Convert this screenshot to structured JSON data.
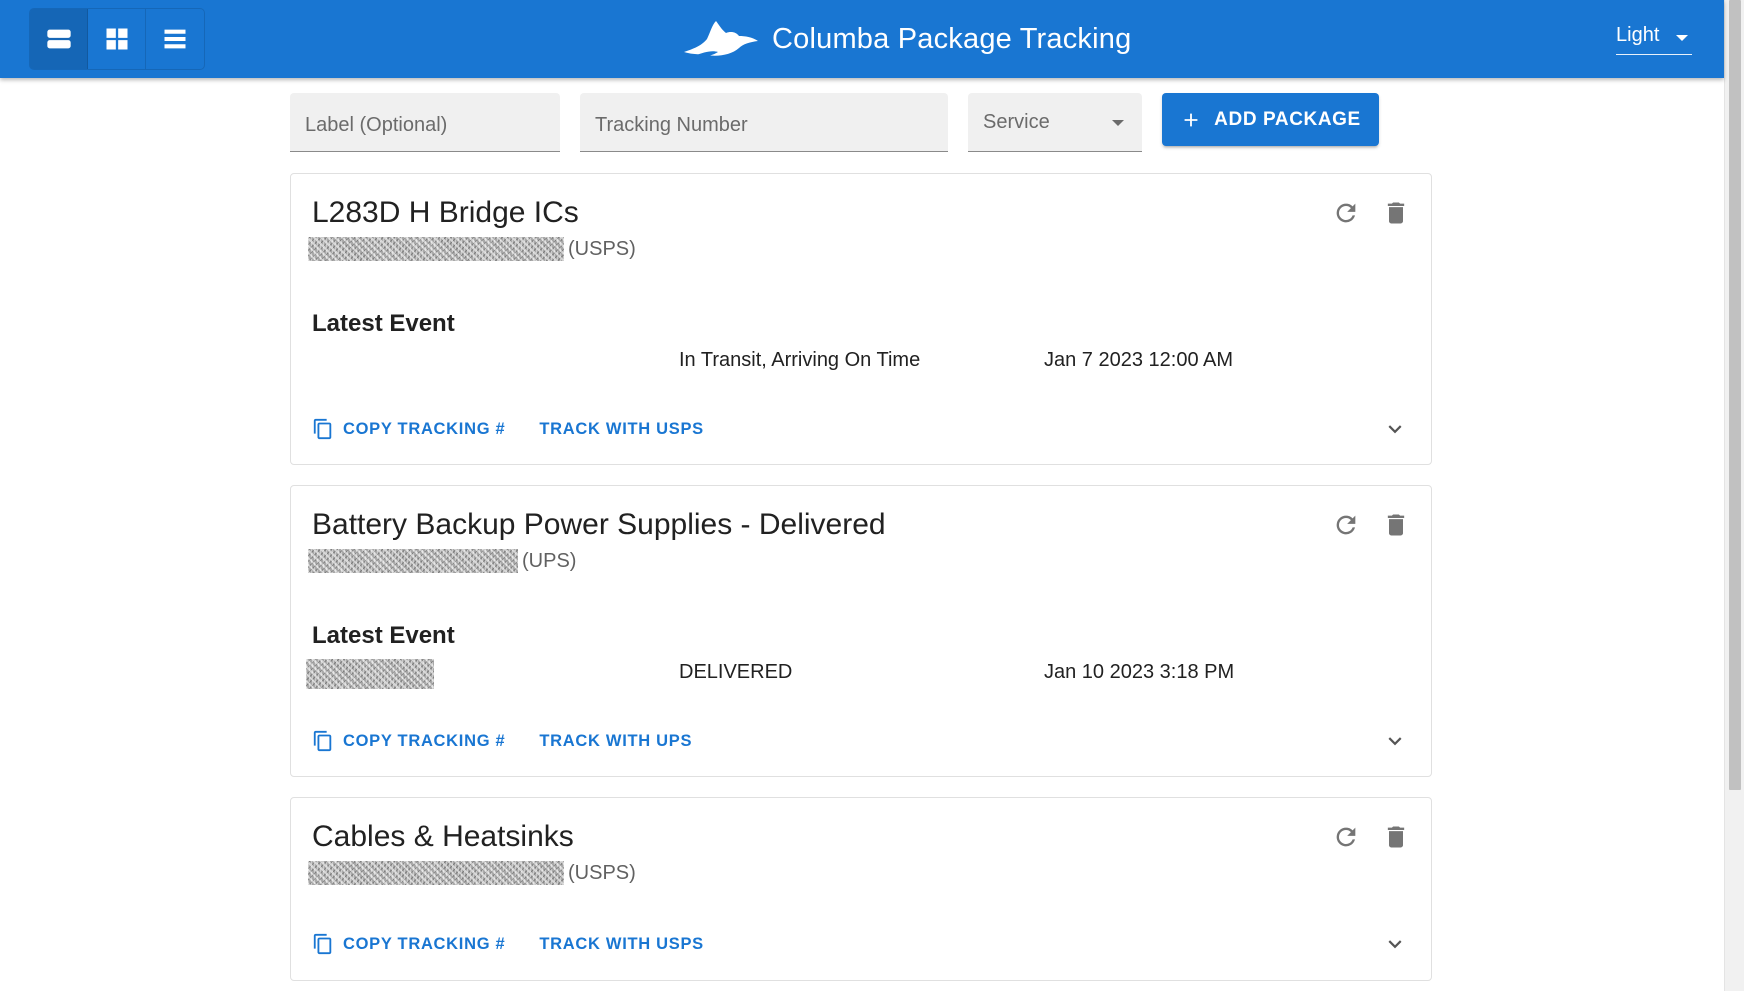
{
  "header": {
    "app_title": "Columba Package Tracking",
    "logo_icon": "dove-logo",
    "view_modes": [
      {
        "name": "list-view",
        "icon": "view-agenda-icon",
        "active": true
      },
      {
        "name": "grid-view",
        "icon": "view-grid-icon",
        "active": false
      },
      {
        "name": "compact-view",
        "icon": "view-list-icon",
        "active": false
      }
    ],
    "theme": {
      "selected": "Light"
    }
  },
  "form": {
    "label_placeholder": "Label (Optional)",
    "tracking_placeholder": "Tracking Number",
    "service_placeholder": "Service",
    "add_button_label": "ADD PACKAGE"
  },
  "packages": [
    {
      "title": "L283D H Bridge ICs",
      "service": "(USPS)",
      "latest_event_heading": "Latest Event",
      "event_status": "In Transit, Arriving On Time",
      "event_date": "Jan 7 2023 12:00 AM",
      "copy_label": "COPY TRACKING #",
      "track_label": "TRACK WITH USPS"
    },
    {
      "title": "Battery Backup Power Supplies - Delivered",
      "service": "(UPS)",
      "latest_event_heading": "Latest Event",
      "event_status": "DELIVERED",
      "event_date": "Jan 10 2023 3:18 PM",
      "copy_label": "COPY TRACKING #",
      "track_label": "TRACK WITH UPS"
    },
    {
      "title": "Cables & Heatsinks",
      "service": "(USPS)",
      "copy_label": "COPY TRACKING #",
      "track_label": "TRACK WITH USPS"
    }
  ],
  "colors": {
    "primary": "#1976d2",
    "icon_gray": "#757575",
    "field_bg": "#f0f0f0"
  }
}
